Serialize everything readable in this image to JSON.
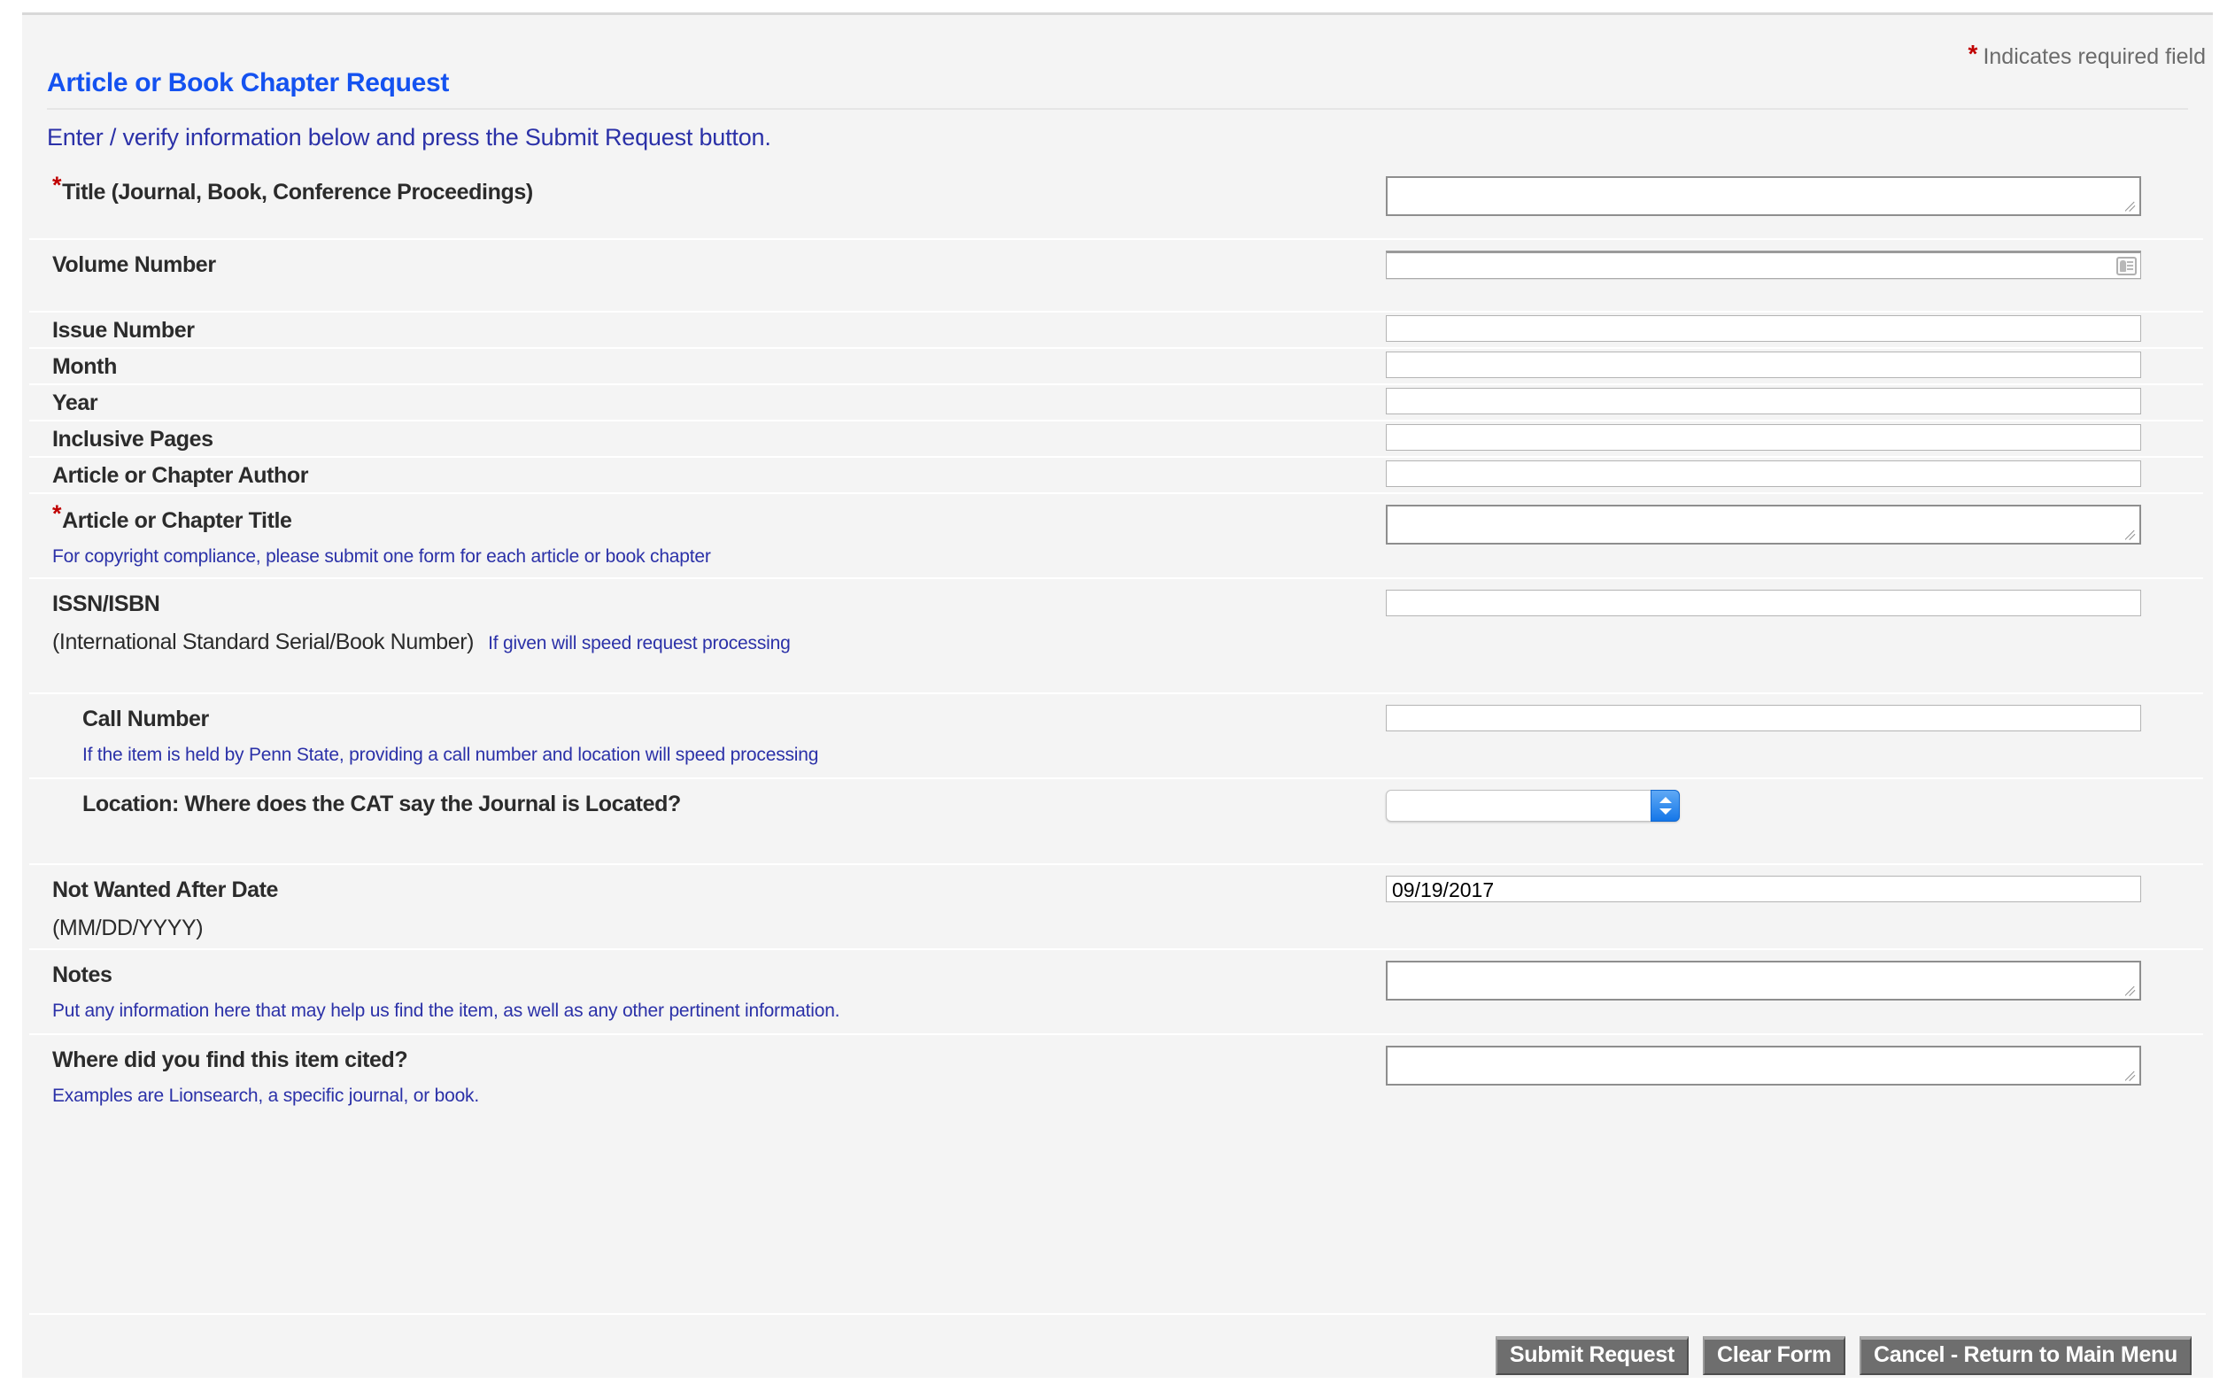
{
  "header": {
    "required_note": "Indicates required field",
    "required_star": "*",
    "title": "Article or Book Chapter Request",
    "subtitle": "Enter / verify information below and press the Submit Request button."
  },
  "form": {
    "rows": [
      {
        "label": "Title (Journal, Book, Conference Proceedings)",
        "required": true,
        "control": "textarea",
        "value": ""
      },
      {
        "label": "Volume Number",
        "required": false,
        "control": "text-autofill",
        "value": "",
        "icon": "contact-card-icon"
      },
      {
        "label": "Issue Number",
        "required": false,
        "control": "text",
        "value": ""
      },
      {
        "label": "Month",
        "required": false,
        "control": "text",
        "value": ""
      },
      {
        "label": "Year",
        "required": false,
        "control": "text",
        "value": ""
      },
      {
        "label": "Inclusive Pages",
        "required": false,
        "control": "text",
        "value": ""
      },
      {
        "label": "Article or Chapter Author",
        "required": false,
        "control": "text",
        "value": ""
      },
      {
        "label": "Article or Chapter Title",
        "required": true,
        "control": "textarea",
        "value": "",
        "hint": "For copyright compliance, please submit one form for each article or book chapter"
      },
      {
        "label": "ISSN/ISBN",
        "required": false,
        "control": "text",
        "value": "",
        "sublabel": "(International Standard Serial/Book Number)",
        "hint_inline": "If given will speed request processing"
      },
      {
        "label": "Call Number",
        "required": false,
        "control": "text",
        "value": "",
        "indent": true,
        "hint": "If the item is held by Penn State, providing a call number and location will speed processing"
      },
      {
        "label": "Location: Where does the CAT say the Journal is Located?",
        "required": false,
        "control": "select",
        "value": "",
        "indent": true,
        "options": [
          ""
        ]
      },
      {
        "label": "Not Wanted After Date",
        "required": false,
        "control": "text",
        "value": "09/19/2017",
        "sublabel": "(MM/DD/YYYY)"
      },
      {
        "label": "Notes",
        "required": false,
        "control": "textarea",
        "value": "",
        "hint": "Put any information here that may help us find the item, as well as any other pertinent information."
      },
      {
        "label": "Where did you find this item cited?",
        "required": false,
        "control": "textarea",
        "value": "",
        "hint": "Examples are Lionsearch, a specific journal, or book."
      }
    ]
  },
  "buttons": {
    "submit": "Submit Request",
    "clear": "Clear Form",
    "cancel": "Cancel - Return to Main Menu"
  },
  "colors": {
    "title_blue": "#1452f0",
    "hint_blue": "#2b31a8",
    "required_red": "#c00000",
    "button_gray": "#6e6e6e",
    "page_bg": "#f4f4f4"
  }
}
